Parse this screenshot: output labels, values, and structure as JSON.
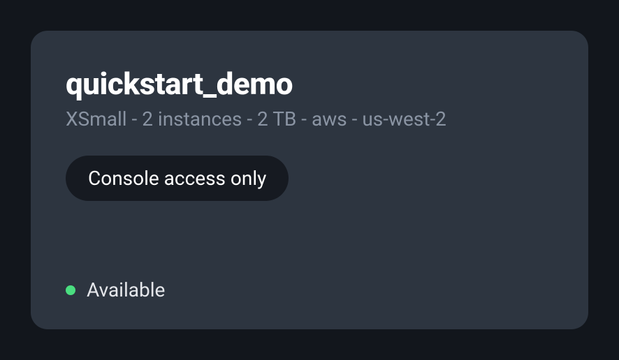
{
  "card": {
    "title": "quickstart_demo",
    "subtitle": "XSmall - 2 instances - 2 TB - aws - us-west-2",
    "badge_label": "Console access only",
    "status": {
      "label": "Available",
      "color": "#4ade80"
    }
  }
}
